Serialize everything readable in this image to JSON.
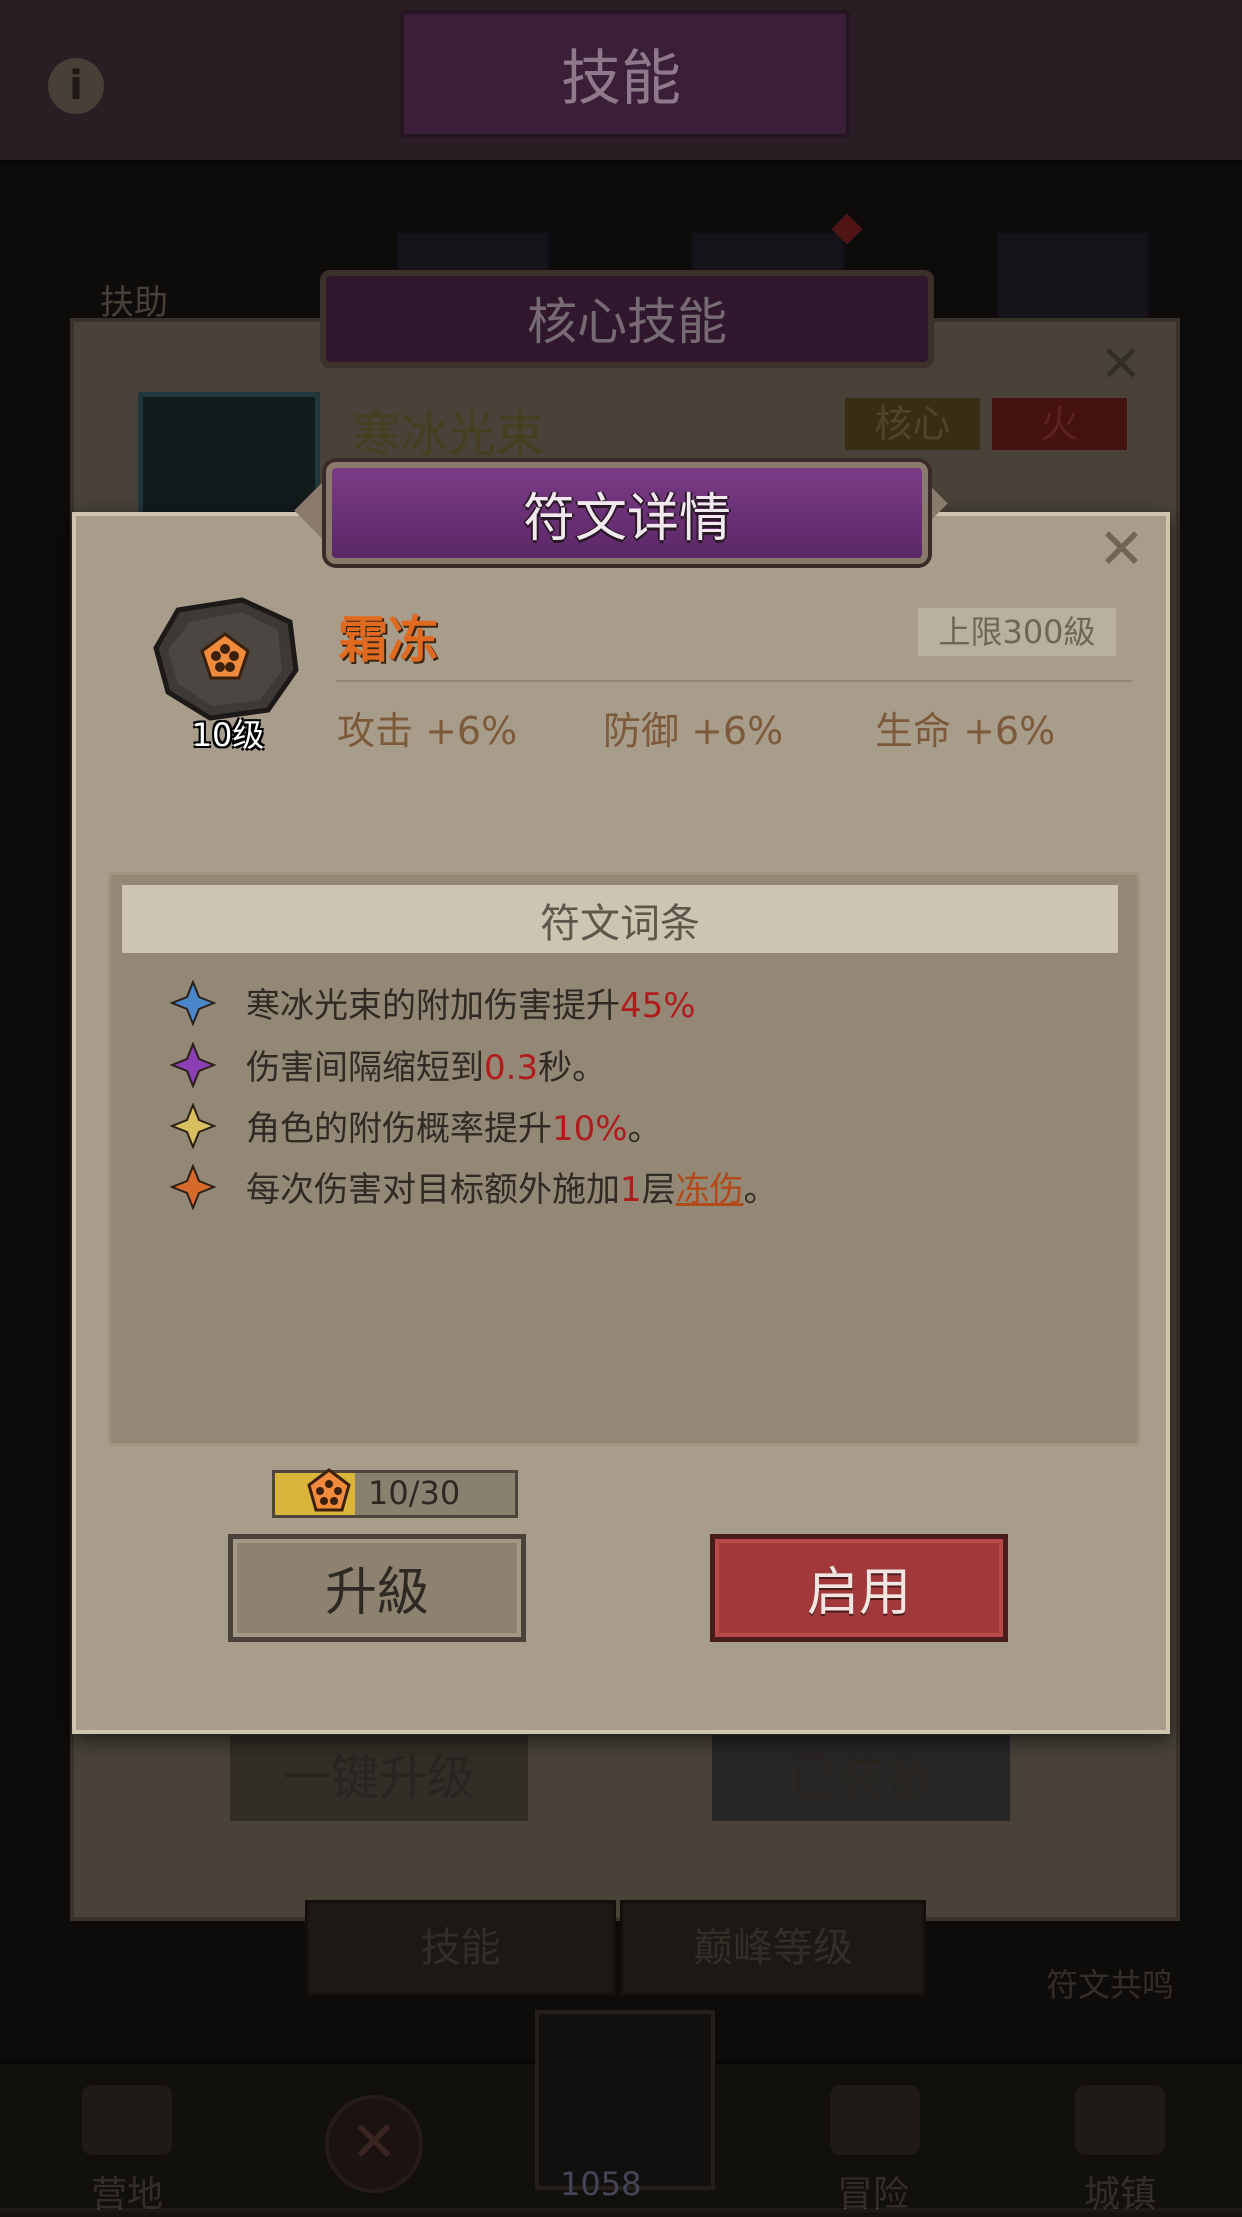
{
  "background": {
    "screen_title": "技能",
    "tab_label_left": "扶助",
    "core_panel": {
      "banner": "核心技能",
      "skill_name": "寒冰光束",
      "tag_core": "核心",
      "tag_fire": "火",
      "one_click_upgrade": "一键升级",
      "equipped": "已装备"
    },
    "lower_tabs": [
      "技能",
      "巅峰等级"
    ],
    "resonance": "符文共鸣",
    "bottom_nav": [
      "营地",
      "冒险",
      "城镇"
    ],
    "gem_count": "1058"
  },
  "rune_panel": {
    "banner": "符文详情",
    "name": "霜冻",
    "level_label": "10级",
    "cap": "上限300級",
    "stats": [
      "攻击 +6%",
      "防御 +6%",
      "生命 +6%"
    ],
    "affix_title": "符文词条",
    "affixes": [
      {
        "icon": "blue-star-icon",
        "color": "#4a86c9",
        "parts": [
          "寒冰光束的附加伤害提升",
          "45%",
          ""
        ]
      },
      {
        "icon": "purple-star-icon",
        "color": "#8a3fb5",
        "parts": [
          "伤害间隔缩短到",
          "0.3",
          "秒。"
        ]
      },
      {
        "icon": "yellow-star-icon",
        "color": "#d8c060",
        "parts": [
          "角色的附伤概率提升",
          "10%",
          "。"
        ]
      },
      {
        "icon": "orange-star-icon",
        "color": "#d76a2a",
        "parts": [
          "每次伤害对目标额外施加",
          "1",
          "层",
          "冻伤",
          "。"
        ]
      }
    ],
    "progress": {
      "current": 10,
      "max": 30,
      "text": "10/30"
    },
    "upgrade_button": "升級",
    "enable_button": "启用"
  }
}
